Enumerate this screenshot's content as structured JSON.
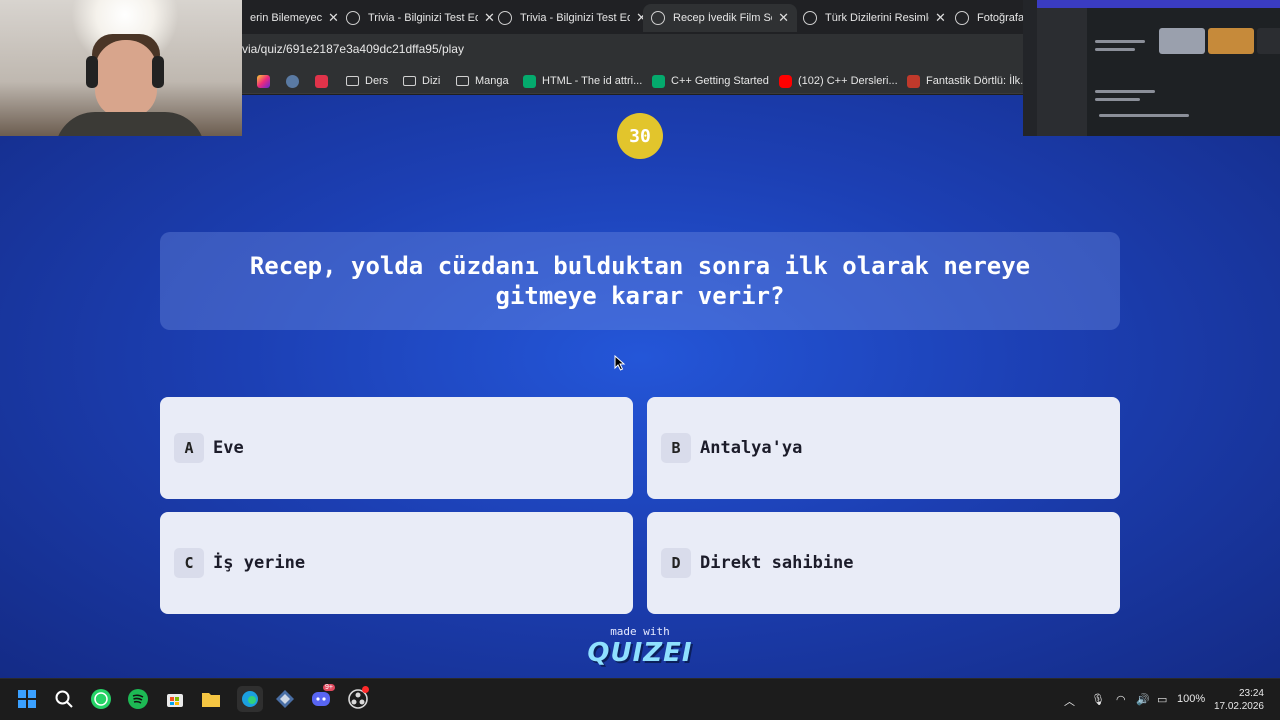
{
  "browser": {
    "tabs": [
      {
        "title": "erin Bilemeyeceği",
        "active": false
      },
      {
        "title": "Trivia - Bilginizi Test Edi",
        "active": false
      },
      {
        "title": "Trivia - Bilginizi Test Edi",
        "active": false
      },
      {
        "title": "Recep İvedik Film Serisi",
        "active": true
      },
      {
        "title": "Türk Dizilerini Resimlerd",
        "active": false
      },
      {
        "title": "Fotoğrafa g",
        "active": false
      }
    ],
    "url": "via/quiz/691e2187e3a409dc21dffa95/play",
    "bookmarks": [
      {
        "label": "Ders",
        "icon": "folder-icon"
      },
      {
        "label": "Dizi",
        "icon": "folder-icon"
      },
      {
        "label": "Manga",
        "icon": "folder-icon"
      },
      {
        "label": "HTML - The id attri...",
        "icon": "w3schools-icon"
      },
      {
        "label": "C++ Getting Started",
        "icon": "w3schools-icon"
      },
      {
        "label": "(102) C++ Dersleri...",
        "icon": "youtube-icon"
      },
      {
        "label": "Fantastik Dörtlü: İlk...",
        "icon": "movie-icon"
      }
    ]
  },
  "quiz": {
    "timer": "30",
    "question": "Recep, yolda cüzdanı bulduktan sonra ilk olarak nereye gitmeye karar verir?",
    "answers": [
      {
        "letter": "A",
        "text": "Eve"
      },
      {
        "letter": "B",
        "text": "Antalya'ya"
      },
      {
        "letter": "C",
        "text": "İş yerine"
      },
      {
        "letter": "D",
        "text": "Direkt sahibine"
      }
    ],
    "made_with": "made with",
    "logo": "QUIZEI"
  },
  "taskbar": {
    "apps": [
      "windows-start-icon",
      "search-icon",
      "whatsapp-icon",
      "spotify-icon",
      "store-icon",
      "file-explorer-icon",
      "edge-icon",
      "app-icon",
      "discord-icon",
      "obs-icon"
    ],
    "discord_badge": "9+",
    "battery": "100%",
    "time": "23:24",
    "date": "17.02.2026"
  },
  "colors": {
    "page_bg": "#1c3fb3",
    "timer": "#e2c52c",
    "answer_bg": "#e9ecf7"
  }
}
